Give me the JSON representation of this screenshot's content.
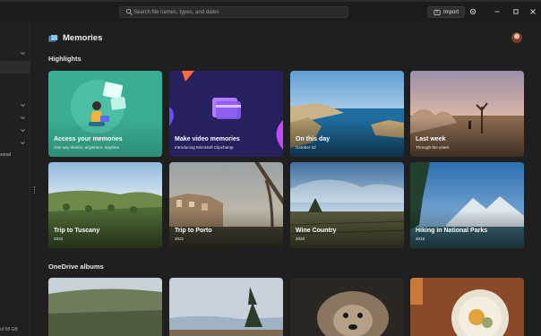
{
  "topbar": {
    "search_placeholder": "Search file names, types, and dates",
    "import_label": "Import",
    "icons": [
      "search-icon",
      "import-icon",
      "gear-icon",
      "minimize-icon",
      "maximize-icon",
      "close-icon"
    ]
  },
  "sidebar": {
    "partial_label": "sonal",
    "bottom_text": "of 58 GB"
  },
  "page": {
    "title": "Memories",
    "highlights_heading": "Highlights",
    "albums_heading": "OneDrive albums"
  },
  "highlights": [
    {
      "title": "Access your memories",
      "subtitle": "One any device, anywhere, anytime",
      "bg": "#3aae94"
    },
    {
      "title": "Make video memories",
      "subtitle": "Introducing Microsoft Clipchamp",
      "bg": "#26205e"
    },
    {
      "title": "On this day",
      "subtitle": "October 12",
      "bg": "#2f6fa3"
    },
    {
      "title": "Last week",
      "subtitle": "Through the years",
      "bg": "#8c6a5a"
    },
    {
      "title": "Trip to Tuscany",
      "subtitle": "2022",
      "bg": "#5a7a4a"
    },
    {
      "title": "Trip to Porto",
      "subtitle": "2021",
      "bg": "#7a6a5a"
    },
    {
      "title": "Wine Country",
      "subtitle": "2020",
      "bg": "#4a6a8a"
    },
    {
      "title": "Hiking in National Parks",
      "subtitle": "2019",
      "bg": "#3f77b0"
    }
  ]
}
